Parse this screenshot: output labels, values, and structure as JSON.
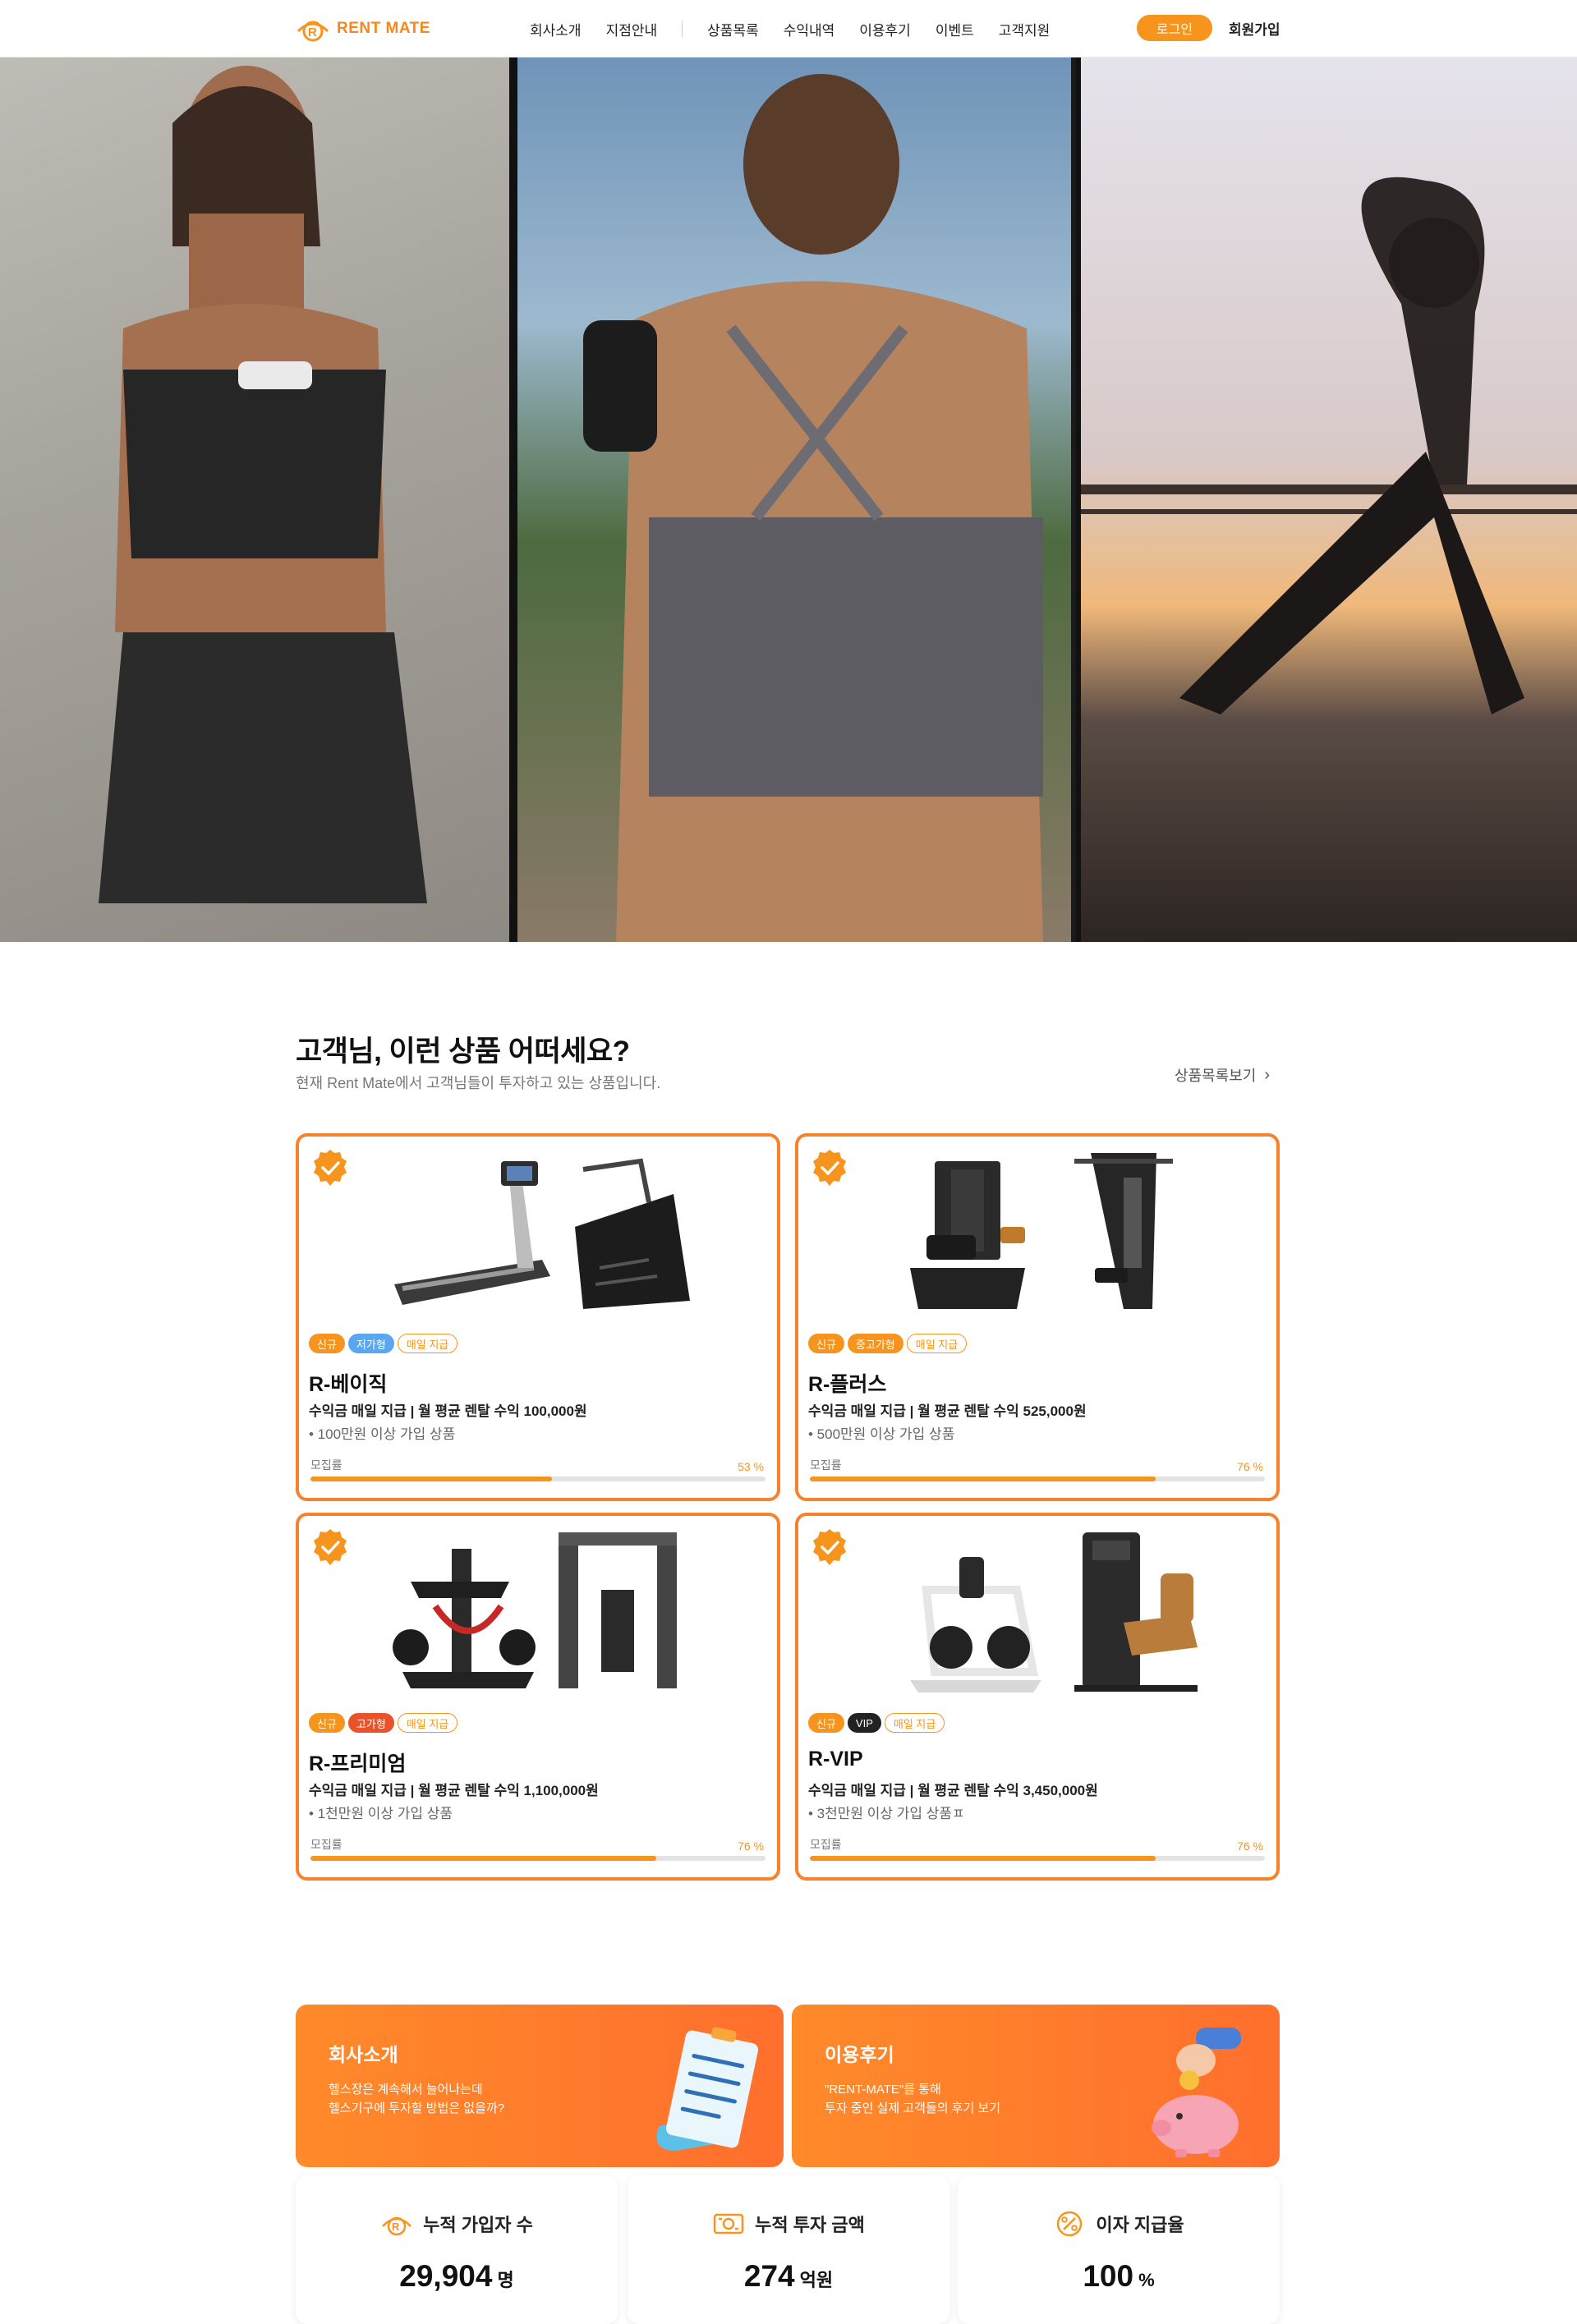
{
  "header": {
    "brand": "RENT MATE",
    "nav": [
      "회사소개",
      "지점안내",
      "상품목록",
      "수익내역",
      "이용후기",
      "이벤트",
      "고객지원"
    ],
    "login_label": "로그인",
    "signup_label": "회원가입"
  },
  "colors": {
    "accent": "#f7941d",
    "card_border": "#f7822b",
    "promo": "#ff7a2b"
  },
  "products": {
    "title": "고객님, 이런 상품 어떠세요?",
    "subtitle": "현재 Rent Mate에서 고객님들이 투자하고 있는 상품입니다.",
    "more_label": "상품목록보기",
    "progress_label": "모집률",
    "items": [
      {
        "name": "R-베이직",
        "tags": [
          "신규",
          "저가형",
          "매일 지급"
        ],
        "type_color": "#5aa7f0",
        "desc": "수익금 매일 지급 | 월 평균 렌탈 수익 100,000원",
        "cond": "• 100만원 이상 가입 상품",
        "pct_text": "53 %",
        "progress": 0.53,
        "equipment": [
          "treadmill",
          "stair-climber"
        ]
      },
      {
        "name": "R-플러스",
        "tags": [
          "신규",
          "중고가형",
          "매일 지급"
        ],
        "type_color": "#f7941d",
        "desc": "수익금 매일 지급 | 월 평균 렌탈 수익 525,000원",
        "cond": "• 500만원 이상 가입 상품",
        "pct_text": "76 %",
        "progress": 0.76,
        "equipment": [
          "leg-extension",
          "lat-pulldown"
        ]
      },
      {
        "name": "R-프리미엄",
        "tags": [
          "신규",
          "고가형",
          "매일 지급"
        ],
        "type_color": "#e8532b",
        "desc": "수익금 매일 지급 | 월 평균 렌탈 수익 1,100,000원",
        "cond": "• 1천만원 이상 가입 상품",
        "pct_text": "76 %",
        "progress": 0.76,
        "equipment": [
          "chest-press",
          "cable-crossover"
        ]
      },
      {
        "name": "R-VIP",
        "tags": [
          "신규",
          "VIP",
          "매일 지급"
        ],
        "type_color": "#222222",
        "desc": "수익금 매일 지급 | 월 평균 렌탈 수익 3,450,000원",
        "cond": "• 3천만원 이상 가입 상품ㅍ",
        "pct_text": "76 %",
        "progress": 0.76,
        "equipment": [
          "row-machine",
          "leg-curl"
        ]
      }
    ]
  },
  "promos": [
    {
      "title": "회사소개",
      "line1": "헬스장은 계속해서 늘어나는데",
      "line2": "헬스기구에 투자할 방법은 없을까?",
      "art": "checklist-icon"
    },
    {
      "title": "이용후기",
      "line1": "\"RENT-MATE\"를 통해",
      "line2": "투자 중인 실제 고객들의 후기 보기",
      "art": "piggy-bank-icon"
    }
  ],
  "stats": [
    {
      "label": "누적 가입자 수",
      "value": "29,904",
      "unit": "명",
      "icon": "users-icon"
    },
    {
      "label": "누적 투자 금액",
      "value": "274",
      "unit": "억원",
      "icon": "money-icon"
    },
    {
      "label": "이자 지급율",
      "value": "100",
      "unit": "%",
      "icon": "percent-icon"
    }
  ]
}
